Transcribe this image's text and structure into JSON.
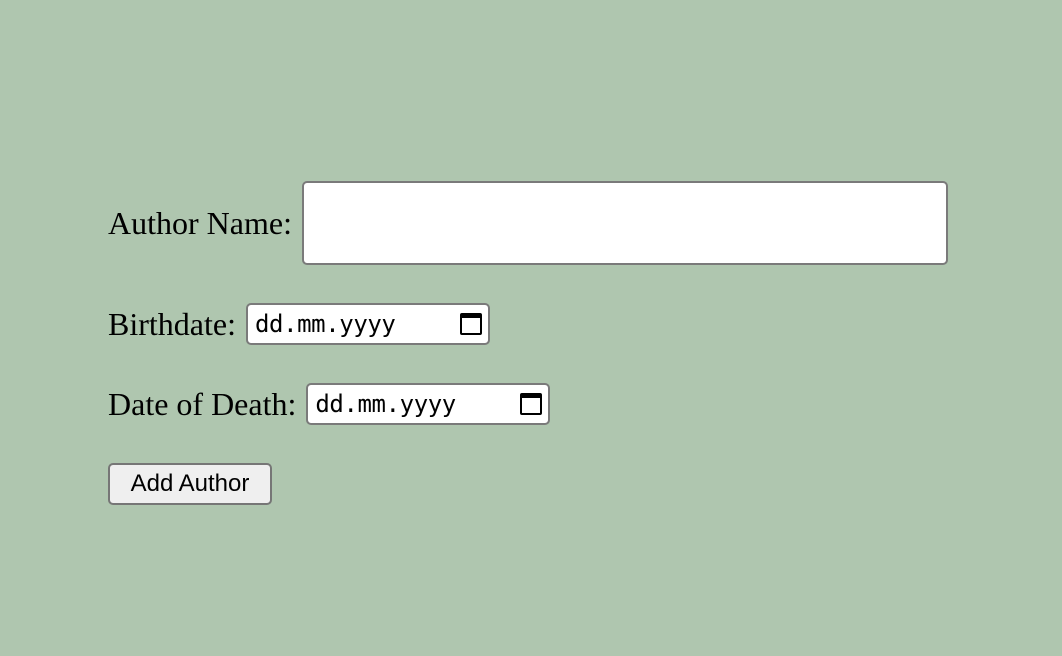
{
  "form": {
    "author_name_label": "Author Name:",
    "author_name_value": "",
    "birthdate_label": "Birthdate:",
    "birthdate_placeholder": "dd.mm.yyyy",
    "date_of_death_label": "Date of Death:",
    "date_of_death_placeholder": "dd.mm.yyyy",
    "submit_label": "Add Author"
  },
  "icons": {
    "birthdate_picker": "calendar-icon",
    "death_picker": "calendar-icon"
  },
  "colors": {
    "background": "#afc6af",
    "input_background": "#ffffff",
    "button_background": "#efefef"
  }
}
